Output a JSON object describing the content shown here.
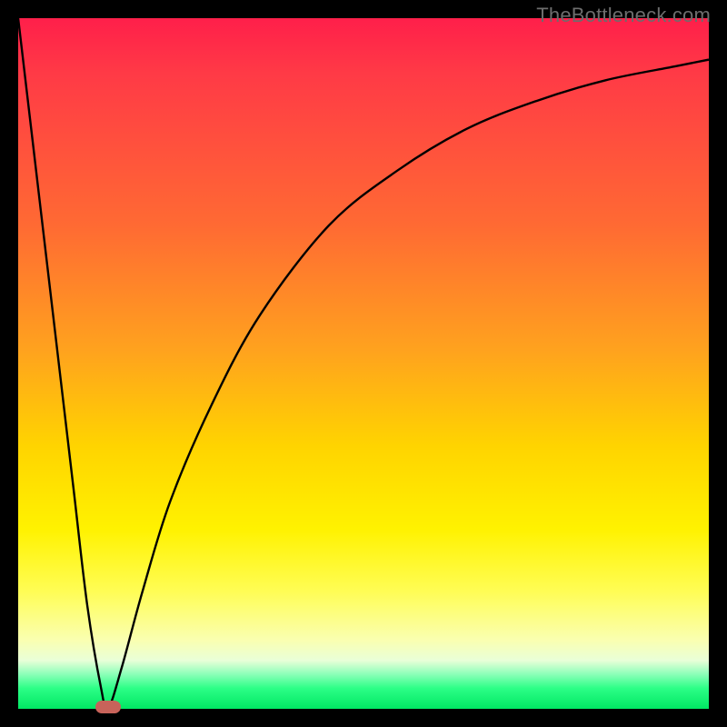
{
  "watermark": "TheBottleneck.com",
  "chart_data": {
    "type": "line",
    "title": "",
    "xlabel": "",
    "ylabel": "",
    "xlim": [
      0,
      100
    ],
    "ylim": [
      0,
      100
    ],
    "grid": false,
    "legend": false,
    "background_gradient": {
      "orientation": "vertical",
      "stops": [
        {
          "pos": 0,
          "color": "#ff1f4a"
        },
        {
          "pos": 30,
          "color": "#ff6a33"
        },
        {
          "pos": 62,
          "color": "#ffd400"
        },
        {
          "pos": 83,
          "color": "#fffd55"
        },
        {
          "pos": 95,
          "color": "#8bffb8"
        },
        {
          "pos": 100,
          "color": "#00e763"
        }
      ]
    },
    "series": [
      {
        "name": "bottleneck-curve",
        "x": [
          0,
          2,
          4,
          6,
          8,
          10,
          12,
          13,
          15,
          18,
          22,
          28,
          35,
          45,
          55,
          65,
          75,
          85,
          95,
          100
        ],
        "values": [
          100,
          83,
          66,
          49,
          32,
          15,
          3,
          0,
          6,
          17,
          30,
          44,
          57,
          70,
          78,
          84,
          88,
          91,
          93,
          94
        ]
      }
    ],
    "marker": {
      "name": "minimum-marker",
      "x": 13,
      "y": 0,
      "color": "#c8635a"
    }
  }
}
